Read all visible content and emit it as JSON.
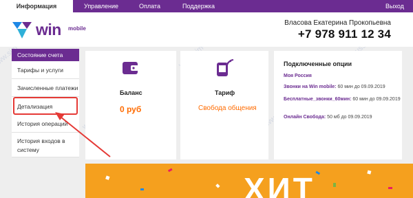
{
  "nav": {
    "tabs": [
      {
        "label": "Информация"
      },
      {
        "label": "Управление"
      },
      {
        "label": "Оплата"
      },
      {
        "label": "Поддержка"
      }
    ],
    "logout": "Выход"
  },
  "header": {
    "logo_text": "win",
    "logo_sub": "mobile",
    "user_name": "Власова Екатерина Прокопьевна",
    "phone": "+7 978 911 12 34"
  },
  "sidebar": {
    "items": [
      {
        "label": "Состояние счета"
      },
      {
        "label": "Тарифы и услуги"
      },
      {
        "label": "Зачисленные платежи"
      },
      {
        "label": "Детализация"
      },
      {
        "label": "История операций"
      },
      {
        "label": "История входов в системy"
      }
    ]
  },
  "balance": {
    "title": "Баланс",
    "value": "0 руб",
    "icon": "wallet-icon"
  },
  "tariff": {
    "title": "Тариф",
    "value": "Свобода общения",
    "icon": "phone-signal-icon"
  },
  "options": {
    "title": "Подключенные опции",
    "items": [
      {
        "name": "Моя Россия",
        "detail": ""
      },
      {
        "name": "Звонки на Win mobile:",
        "detail": "60 мин до 09.09.2019"
      },
      {
        "name": "Бесплатные_звонки_60мин:",
        "detail": "60 мин до 09.09.2019"
      },
      {
        "name": "Онлайн Свобода:",
        "detail": "50 мб до 09.09.2019"
      }
    ]
  },
  "banner": {
    "text": "ХИТ"
  },
  "watermark": "www.sim-usslugi.ru",
  "colors": {
    "brand": "#6b2c91",
    "accent": "#ff6b00",
    "highlight": "#e53935",
    "logo_blue": "#1e88e5"
  }
}
